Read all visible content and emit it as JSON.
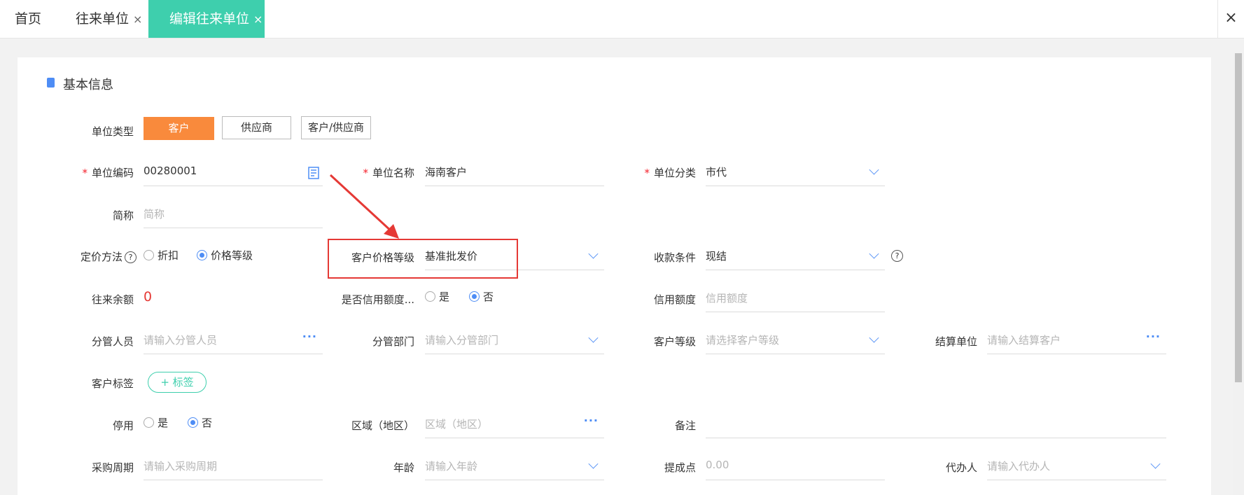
{
  "tabs": [
    {
      "label": "首页"
    },
    {
      "label": "往来单位",
      "close": "×"
    },
    {
      "label": "编辑往来单位",
      "close": "×"
    }
  ],
  "close_all": "×",
  "section_title": "基本信息",
  "unit_type": {
    "label": "单位类型",
    "options": [
      "客户",
      "供应商",
      "客户/供应商"
    ],
    "selected": "客户"
  },
  "unit_code": {
    "label": "单位编码",
    "required": "*",
    "value": "00280001"
  },
  "unit_name": {
    "label": "单位名称",
    "required": "*",
    "value": "海南客户"
  },
  "unit_category": {
    "label": "单位分类",
    "required": "*",
    "value": "市代"
  },
  "short_name": {
    "label": "简称",
    "placeholder": "简称"
  },
  "pricing_method": {
    "label": "定价方法",
    "help": "?",
    "options": [
      "折扣",
      "价格等级"
    ],
    "selected": "价格等级"
  },
  "price_level": {
    "label": "客户价格等级",
    "value": "基准批发价"
  },
  "payment_terms": {
    "label": "收款条件",
    "value": "现结",
    "help": "?"
  },
  "balance": {
    "label": "往来余额",
    "value": "0"
  },
  "credit_limit_enabled": {
    "label": "是否信用额度...",
    "options": [
      "是",
      "否"
    ],
    "selected": "否"
  },
  "credit_limit": {
    "label": "信用额度",
    "placeholder": "信用额度"
  },
  "manager": {
    "label": "分管人员",
    "placeholder": "请输入分管人员"
  },
  "department": {
    "label": "分管部门",
    "placeholder": "请输入分管部门"
  },
  "customer_level": {
    "label": "客户等级",
    "placeholder": "请选择客户等级"
  },
  "settlement_unit": {
    "label": "结算单位",
    "placeholder": "请输入结算客户"
  },
  "customer_tags": {
    "label": "客户标签",
    "button": "+ 标签"
  },
  "disabled": {
    "label": "停用",
    "options": [
      "是",
      "否"
    ],
    "selected": "否"
  },
  "region": {
    "label": "区域（地区）",
    "placeholder": "区域（地区）"
  },
  "remark": {
    "label": "备注"
  },
  "purchase_cycle": {
    "label": "采购周期",
    "placeholder": "请输入采购周期"
  },
  "age": {
    "label": "年龄",
    "placeholder": "请输入年龄"
  },
  "commission": {
    "label": "提成点",
    "placeholder": "0.00"
  },
  "agent": {
    "label": "代办人",
    "placeholder": "请输入代办人"
  },
  "colors": {
    "accent": "#3ecfad",
    "orange": "#f98a3c",
    "blue": "#4e8df5",
    "red": "#e53935"
  }
}
